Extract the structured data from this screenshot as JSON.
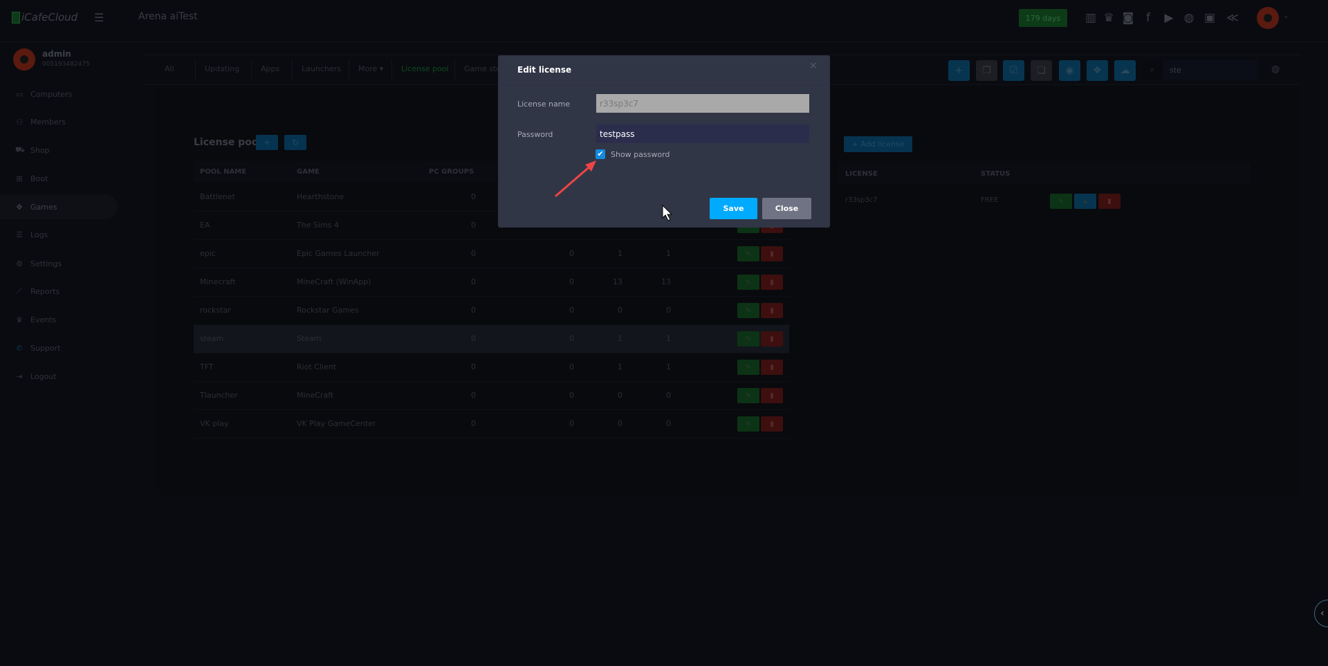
{
  "topbar": {
    "logo": "iCafeCloud",
    "title": "Arena aiTest",
    "days_badge": "179 days",
    "icons": [
      "leaderboard-icon",
      "trophy-icon",
      "discord-icon",
      "facebook-icon",
      "youtube-icon",
      "globe-icon",
      "icafe-icon",
      "ggrock-icon"
    ]
  },
  "user": {
    "name": "admin",
    "id": "005193482475"
  },
  "sidebar": {
    "items": [
      {
        "label": "Computers",
        "icon": "monitor-icon"
      },
      {
        "label": "Members",
        "icon": "users-icon"
      },
      {
        "label": "Shop",
        "icon": "cart-icon"
      },
      {
        "label": "Boot",
        "icon": "windows-icon"
      },
      {
        "label": "Games",
        "icon": "gamepad-icon",
        "active": true
      },
      {
        "label": "Logs",
        "icon": "list-icon"
      },
      {
        "label": "Settings",
        "icon": "gear-icon"
      },
      {
        "label": "Reports",
        "icon": "chart-icon"
      },
      {
        "label": "Events",
        "icon": "crown-icon"
      },
      {
        "label": "Support",
        "icon": "phone-icon"
      },
      {
        "label": "Logout",
        "icon": "logout-icon"
      }
    ]
  },
  "tabs": [
    "All",
    "Updating",
    "Apps",
    "Launchers",
    "More ▾",
    "License pool",
    "Game sto"
  ],
  "search": {
    "value": "ste"
  },
  "license_pool": {
    "title": "License pool",
    "columns": [
      "POOL NAME",
      "GAME",
      "PC GROUPS"
    ],
    "rows": [
      {
        "pool": "Battlenet",
        "game": "Hearthstone",
        "pc_groups": "0",
        "c2": "",
        "c3": "",
        "c4": ""
      },
      {
        "pool": "EA",
        "game": "The Sims 4",
        "pc_groups": "0",
        "c2": "",
        "c3": "",
        "c4": ""
      },
      {
        "pool": "epic",
        "game": "Epic Games Launcher",
        "pc_groups": "0",
        "c2": "0",
        "c3": "1",
        "c4": "1"
      },
      {
        "pool": "Minecraft",
        "game": "MineCraft (WinApp)",
        "pc_groups": "0",
        "c2": "0",
        "c3": "13",
        "c4": "13"
      },
      {
        "pool": "rockstar",
        "game": "Rockstar Games",
        "pc_groups": "0",
        "c2": "0",
        "c3": "0",
        "c4": "0"
      },
      {
        "pool": "steam",
        "game": "Steam",
        "pc_groups": "0",
        "c2": "0",
        "c3": "1",
        "c4": "1"
      },
      {
        "pool": "TFT",
        "game": "Riot Client",
        "pc_groups": "0",
        "c2": "0",
        "c3": "1",
        "c4": "1"
      },
      {
        "pool": "Tlauncher",
        "game": "MineCraft",
        "pc_groups": "0",
        "c2": "0",
        "c3": "0",
        "c4": "0"
      },
      {
        "pool": "VK play",
        "game": "VK Play GameCenter",
        "pc_groups": "0",
        "c2": "0",
        "c3": "0",
        "c4": "0"
      }
    ]
  },
  "licenses": {
    "add_label": "+ Add license",
    "columns": [
      "LICENSE",
      "STATUS"
    ],
    "rows": [
      {
        "license": "r33sp3c7",
        "status": "FREE"
      }
    ]
  },
  "modal": {
    "title": "Edit license",
    "license_name_label": "License name",
    "license_name_value": "r33sp3c7",
    "password_label": "Password",
    "password_value": "testpass",
    "show_password_label": "Show password",
    "show_password_checked": true,
    "save_label": "Save",
    "close_label": "Close"
  },
  "colors": {
    "save": "#00aaff",
    "close": "#6f7384",
    "checkbox": "#118be0",
    "modal_bg": "#313646",
    "annotation_arrow": "#ef4444"
  }
}
